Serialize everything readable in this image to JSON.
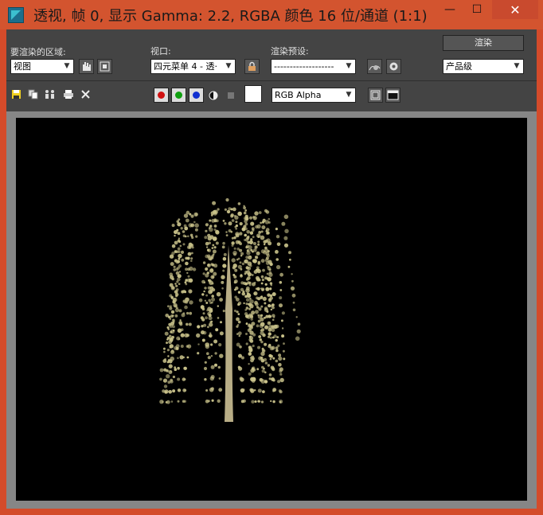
{
  "window": {
    "title": "透视, 帧 0, 显示 Gamma: 2.2, RGBA 颜色 16 位/通道 (1:1)",
    "min_glyph": "—",
    "max_glyph": "☐",
    "close_glyph": "✕"
  },
  "toolbar": {
    "area_label": "要渲染的区域:",
    "area_value": "视图",
    "viewport_label": "视口:",
    "viewport_value": "四元菜单 4 - 透·",
    "preset_label": "渲染预设:",
    "preset_value": "-------------------",
    "render_button": "渲染",
    "quality_value": "产品级",
    "channel_value": "RGB Alpha"
  },
  "colors": {
    "titlebar": "#d3542f",
    "panel": "#444444",
    "viewport_bg": "#000000",
    "foliage": "#c9c28a",
    "trunk": "#b8ad86"
  }
}
